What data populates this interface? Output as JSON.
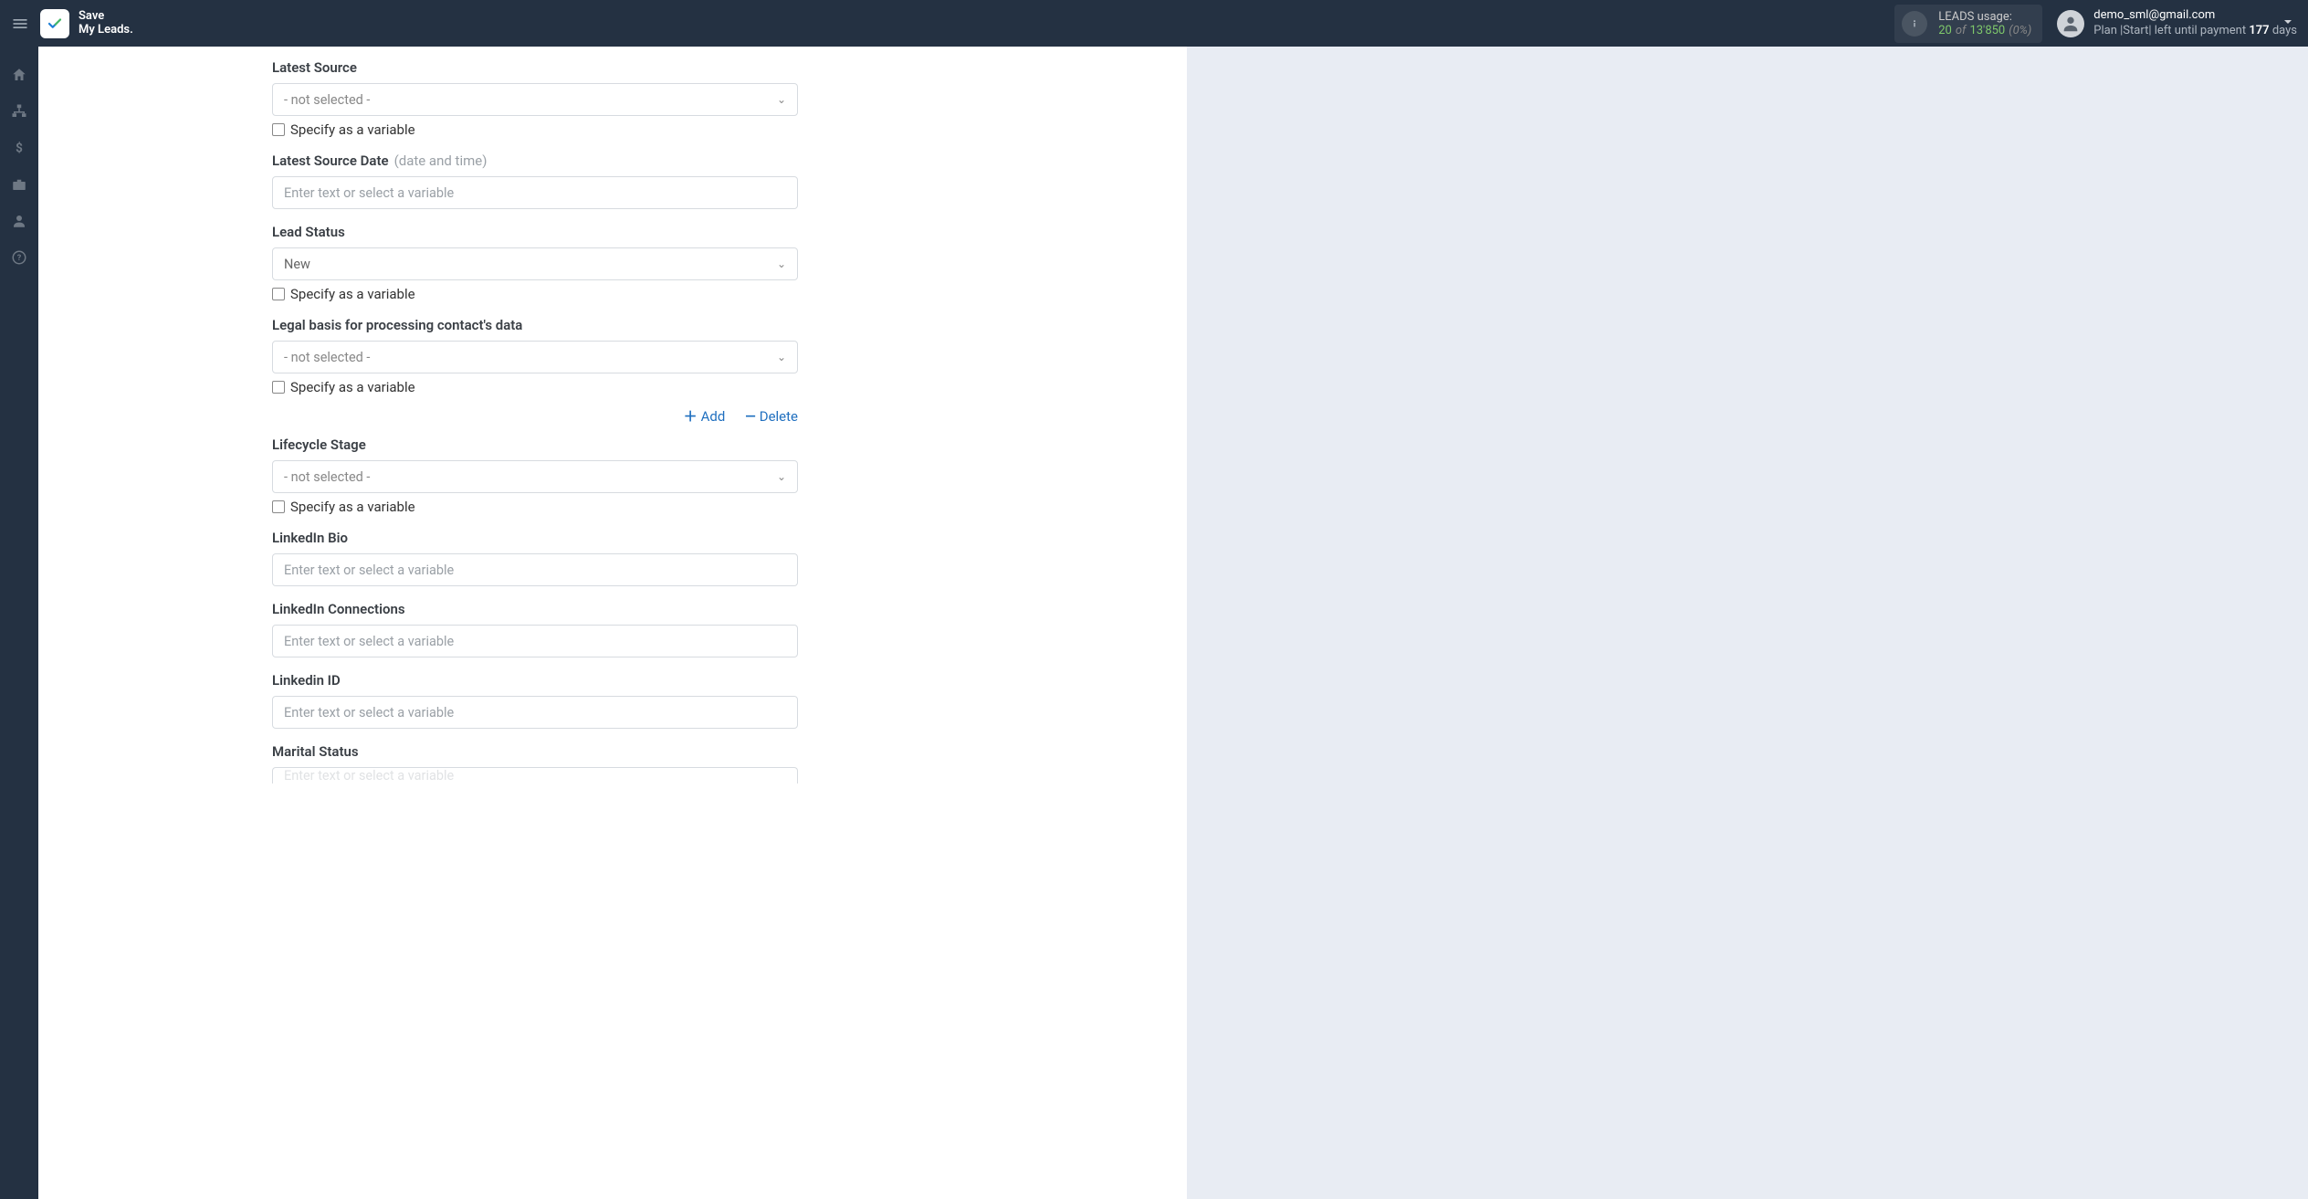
{
  "brand": {
    "line1": "Save",
    "line2": "My Leads."
  },
  "usage": {
    "label": "LEADS usage:",
    "count": "20",
    "of": "of",
    "total": "13'850",
    "pct": "(0%)"
  },
  "user": {
    "email": "demo_sml@gmail.com",
    "plan_prefix": "Plan |",
    "plan_name": "Start",
    "plan_mid": "| left until payment ",
    "days_num": "177",
    "days_suffix": " days"
  },
  "actions": {
    "add": "Add",
    "delete": "Delete"
  },
  "common": {
    "not_selected": "- not selected -",
    "specify_var": "Specify as a variable",
    "placeholder_text": "Enter text or select a variable"
  },
  "fields": {
    "latest_source": {
      "label": "Latest Source",
      "value": "- not selected -"
    },
    "latest_source_date": {
      "label": "Latest Source Date",
      "hint": "(date and time)"
    },
    "lead_status": {
      "label": "Lead Status",
      "value": "New"
    },
    "legal_basis": {
      "label": "Legal basis for processing contact's data",
      "value": "- not selected -"
    },
    "lifecycle_stage": {
      "label": "Lifecycle Stage",
      "value": "- not selected -"
    },
    "linkedin_bio": {
      "label": "LinkedIn Bio"
    },
    "linkedin_connections": {
      "label": "LinkedIn Connections"
    },
    "linkedin_id": {
      "label": "Linkedin ID"
    },
    "marital_status": {
      "label": "Marital Status"
    }
  }
}
